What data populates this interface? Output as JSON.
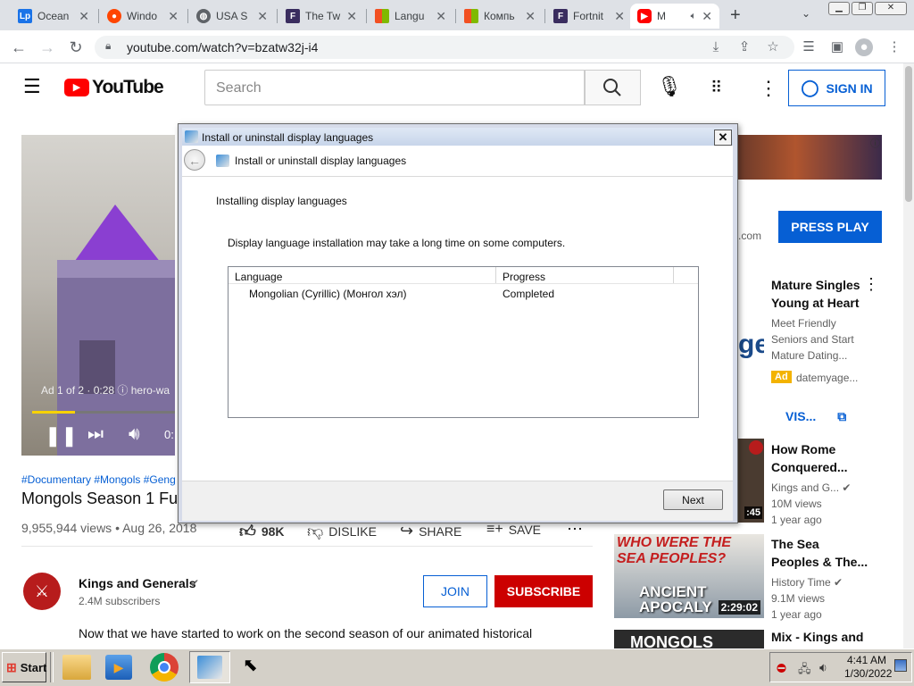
{
  "tabs": [
    {
      "title": "Ocean",
      "icon": "lp-icon",
      "color": "#1a73e8"
    },
    {
      "title": "Windo",
      "icon": "reddit-icon",
      "color": "#ff4500"
    },
    {
      "title": "USA S",
      "icon": "globe-icon",
      "color": "#5f6368"
    },
    {
      "title": "The Tw",
      "icon": "fandom-icon",
      "color": "#3a2d5f"
    },
    {
      "title": "Langu",
      "icon": "microsoft-icon",
      "color": "#f25022"
    },
    {
      "title": "Компь",
      "icon": "microsoft-icon",
      "color": "#f25022"
    },
    {
      "title": "Fortnit",
      "icon": "fandom-icon",
      "color": "#3a2d5f"
    },
    {
      "title": "M",
      "icon": "youtube-icon",
      "color": "#ff0000",
      "active": true
    }
  ],
  "browser": {
    "url": "youtube.com/watch?v=bzatw32j-i4"
  },
  "youtube": {
    "logo": "YouTube",
    "search_placeholder": "Search",
    "sign_in": "SIGN IN",
    "ad_label": "Ad 1 of 2 · 0:28",
    "ad_source": "hero-wa",
    "time_partial": "0:",
    "hashtags": "#Documentary #Mongols #Geng",
    "video_title": "Mongols Season 1 Fu",
    "views_date": "9,955,944 views • Aug 26, 2018",
    "likes": "98K",
    "dislike": "DISLIKE",
    "share": "SHARE",
    "save": "SAVE",
    "channel": "Kings and Generals",
    "subscribers": "2.4M subscribers",
    "join": "JOIN",
    "subscribe": "SUBSCRIBE",
    "description": "Now that we have started to work on the second season of our animated historical",
    "side_ad": {
      "domain_suffix": ".com",
      "cta": "PRESS PLAY"
    },
    "sidebar": [
      {
        "title1": "Mature Singles",
        "title2": "Young at Heart",
        "desc1": "Meet Friendly",
        "desc2": "Seniors and Start",
        "desc3": "Mature Dating...",
        "ad": "Ad",
        "domain": "datemyage...",
        "visit": "VIS..."
      },
      {
        "title1": "How Rome",
        "title2": "Conquered...",
        "channel": "Kings and G...",
        "views": "10M views",
        "age": "1 year ago",
        "duration": ":45"
      },
      {
        "title1": "The Sea",
        "title2": "Peoples & The...",
        "channel": "History Time",
        "views": "9.1M views",
        "age": "1 year ago",
        "duration": "2:29:02",
        "thumb_text1": "WHO WERE THE",
        "thumb_text2": "SEA PEOPLES?",
        "thumb_text3": "ANCIENT",
        "thumb_text4": "APOCALY"
      },
      {
        "title1": "Mix - Kings and",
        "thumb_text": "MONGOLS"
      }
    ]
  },
  "dialog": {
    "window_title": "Install or uninstall display languages",
    "header_title": "Install or uninstall display languages",
    "heading": "Installing display languages",
    "note": "Display language installation may take a long time on some computers.",
    "columns": [
      "Language",
      "Progress"
    ],
    "rows": [
      {
        "language": "Mongolian (Cyrillic) (Монгол хэл)",
        "progress": "Completed"
      }
    ],
    "next": "Next"
  },
  "taskbar": {
    "start": "Start",
    "time": "4:41 AM",
    "date": "1/30/2022"
  }
}
